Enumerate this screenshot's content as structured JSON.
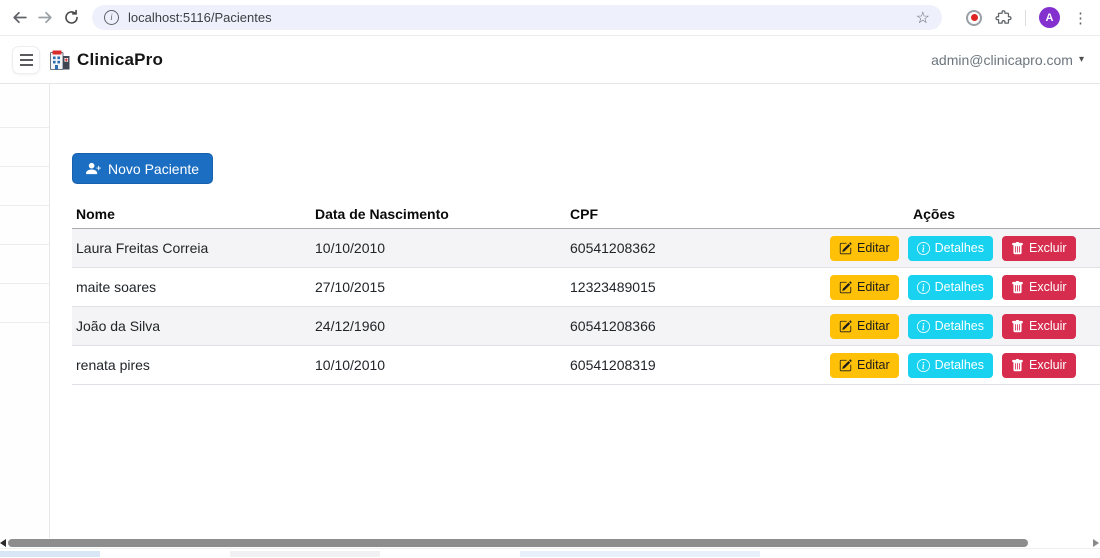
{
  "browser": {
    "url": "localhost:5116/Pacientes",
    "avatar_letter": "A"
  },
  "header": {
    "brand": "ClinicaPro",
    "account": "admin@clinicapro.com"
  },
  "sidebar": {
    "visible_items": 6
  },
  "main": {
    "new_patient_label": "Novo Paciente"
  },
  "table": {
    "columns": [
      "Nome",
      "Data de Nascimento",
      "CPF",
      "Ações"
    ],
    "rows": [
      {
        "nome": "Laura Freitas Correia",
        "nascimento": "10/10/2010",
        "cpf": "60541208362"
      },
      {
        "nome": "maite soares",
        "nascimento": "27/10/2015",
        "cpf": "12323489015"
      },
      {
        "nome": "João da Silva",
        "nascimento": "24/12/1960",
        "cpf": "60541208366"
      },
      {
        "nome": "renata pires",
        "nascimento": "10/10/2010",
        "cpf": "60541208319"
      }
    ],
    "actions": {
      "edit": "Editar",
      "details": "Detalhes",
      "delete": "Excluir"
    }
  },
  "colors": {
    "primary_button": "#1b6ec2",
    "edit_button": "#ffc107",
    "details_button": "#18d2f0",
    "delete_button": "#d62c4e",
    "avatar": "#8430ce",
    "striped_row": "#f4f4f6"
  },
  "icons": [
    "back-icon",
    "forward-icon",
    "reload-icon",
    "site-info-icon",
    "star-icon",
    "record-icon",
    "extensions-icon",
    "browser-menu-icon",
    "menu-toggle-icon",
    "hospital-logo-icon",
    "account-caret-icon",
    "person-plus-icon",
    "pencil-square-icon",
    "info-circle-icon",
    "trash-icon",
    "scroll-left-icon",
    "scroll-right-icon"
  ]
}
